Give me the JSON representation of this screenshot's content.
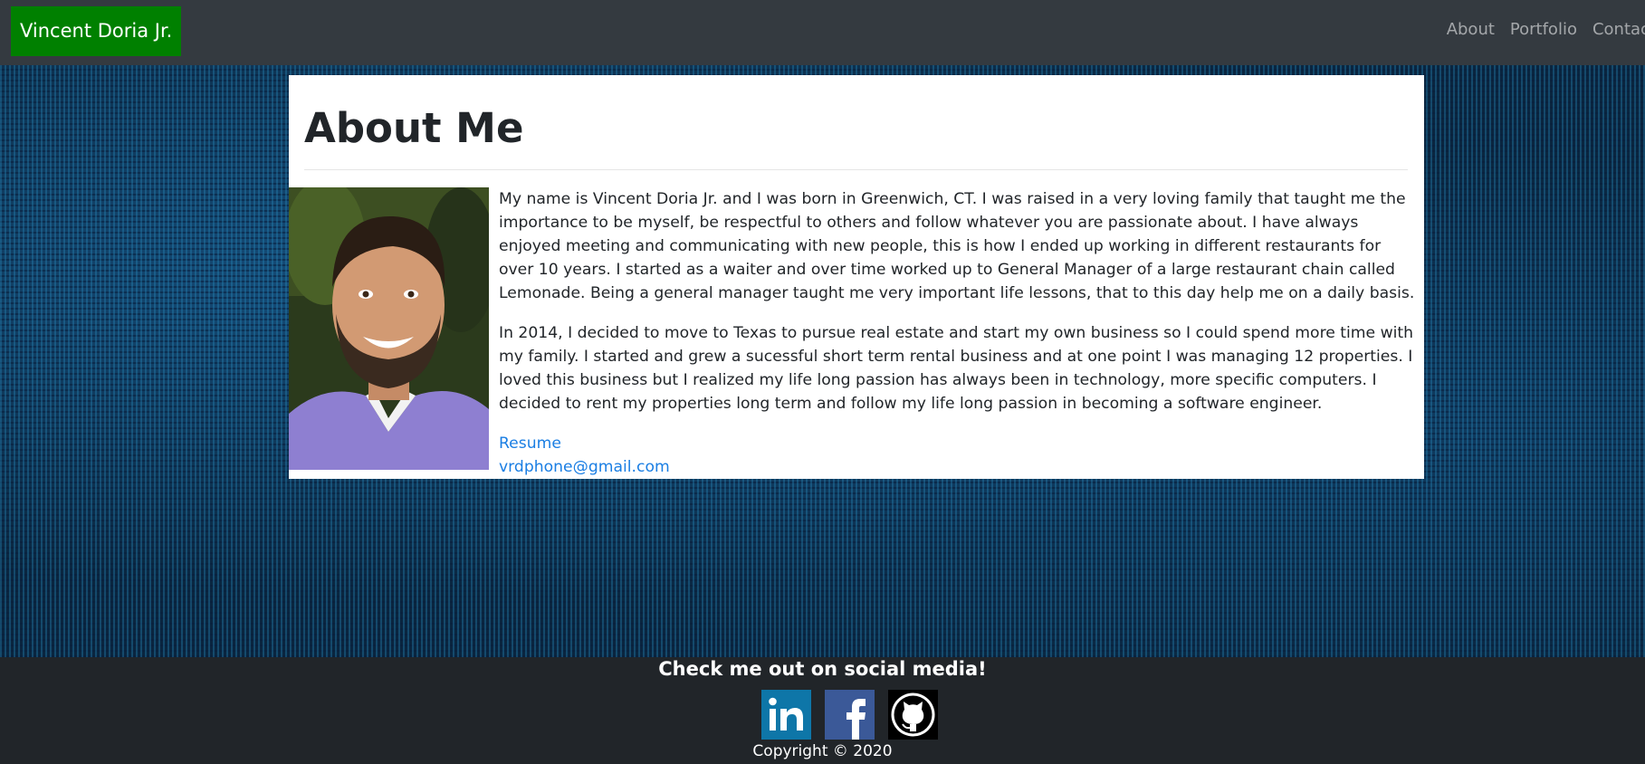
{
  "navbar": {
    "brand": "Vincent Doria Jr.",
    "links": [
      {
        "label": "About"
      },
      {
        "label": "Portfolio"
      },
      {
        "label": "Contact"
      }
    ]
  },
  "about": {
    "title": "About Me",
    "paragraphs": [
      "My name is Vincent Doria Jr. and I was born in Greenwich, CT. I was raised in a very loving family that taught me the importance to be myself, be respectful to others and follow whatever you are passionate about. I have always enjoyed meeting and communicating with new people, this is how I ended up working in different restaurants for over 10 years. I started as a waiter and over time worked up to General Manager of a large restaurant chain called Lemonade. Being a general manager taught me very important life lessons, that to this day help me on a daily basis.",
      "In 2014, I decided to move to Texas to pursue real estate and start my own business so I could spend more time with my family. I started and grew a sucessful short term rental business and at one point I was managing 12 properties. I loved this business but I realized my life long passion has always been in technology, more specific computers. I decided to rent my properties long term and follow my life long passion in becoming a software engineer."
    ],
    "resume_label": "Resume",
    "email": "vrdphone@gmail.com"
  },
  "footer": {
    "heading": "Check me out on social media!",
    "icons": [
      "linkedin-icon",
      "facebook-icon",
      "github-icon"
    ],
    "copyright": "Copyright © 2020"
  },
  "colors": {
    "brand_bg": "#008000",
    "navbar_bg": "#343a40",
    "footer_bg": "#212529",
    "link": "#1a7ee3",
    "linkedin": "#0e76a8",
    "facebook": "#3b5998"
  }
}
